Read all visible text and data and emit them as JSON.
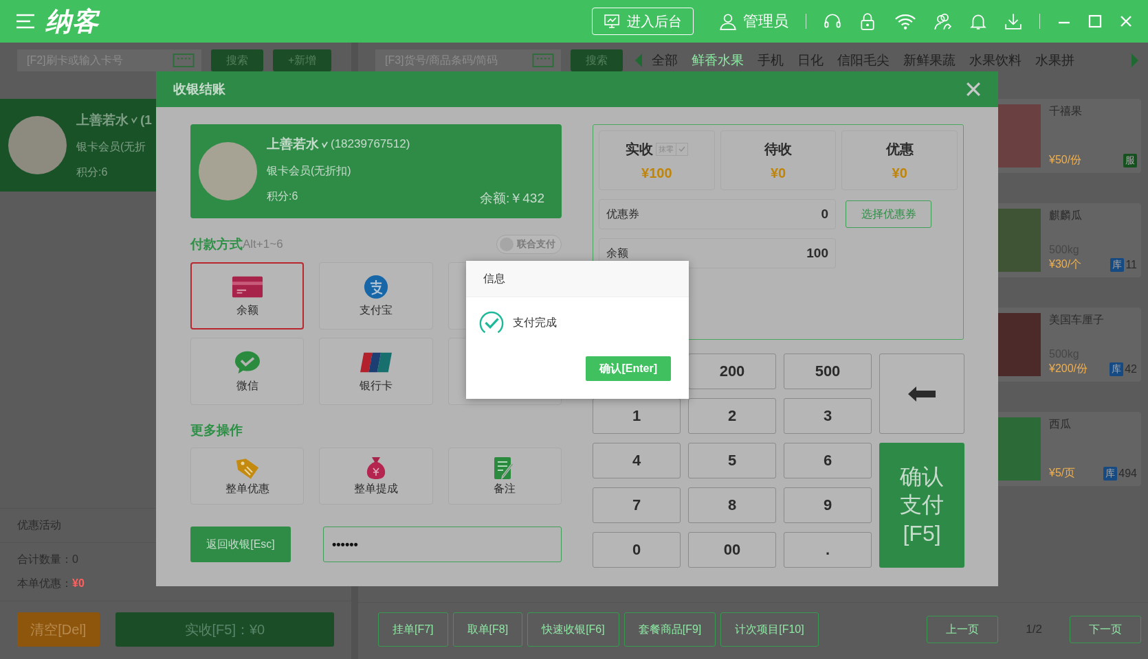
{
  "top_bar": {
    "logo": "纳客",
    "backend_button": "进入后台",
    "user": "管理员"
  },
  "member_panel": {
    "search_placeholder": "[F2]刷卡或输入卡号",
    "search_button": "搜索",
    "add_button": "+新增",
    "member": {
      "name": "上善若水",
      "phone": "(1",
      "level": "银卡会员(无折",
      "points": "积分:6"
    },
    "promo_label": "优惠活动",
    "total_qty": {
      "label": "合计数量：",
      "value": "0"
    },
    "discount": {
      "label": "本单优惠：",
      "value": "¥0"
    },
    "clear_button": "清空[Del]",
    "pay_button": "实收[F5]：¥0"
  },
  "goods_panel": {
    "search_placeholder": "[F3]货号/商品条码/简码",
    "search_button": "搜索",
    "categories": [
      {
        "label": "全部",
        "selected": false
      },
      {
        "label": "鲜香水果",
        "selected": true
      },
      {
        "label": "手机",
        "selected": false
      },
      {
        "label": "日化",
        "selected": false
      },
      {
        "label": "信阳毛尖",
        "selected": false
      },
      {
        "label": "新鲜果蔬",
        "selected": false
      },
      {
        "label": "水果饮料",
        "selected": false
      },
      {
        "label": "水果拼",
        "selected": false
      }
    ],
    "products": [
      {
        "kind": "service",
        "name": "千禧果",
        "price": "¥50/份",
        "badge": "服"
      },
      {
        "kind": "stock",
        "name": "麒麟瓜",
        "spec": "500kg",
        "price": "¥30/个",
        "badge": "库",
        "stock": "11"
      },
      {
        "kind": "stock",
        "name": "美国车厘子",
        "spec": "500kg",
        "price": "¥200/份",
        "badge": "库",
        "stock": "42"
      },
      {
        "kind": "stock",
        "name": "西瓜",
        "price": "¥5/页",
        "badge": "库",
        "stock": "494"
      }
    ],
    "actions": [
      "挂单[F7]",
      "取单[F8]",
      "快速收银[F6]",
      "套餐商品[F9]",
      "计次项目[F10]"
    ],
    "pager": {
      "prev": "上一页",
      "page": "1/2",
      "next": "下一页"
    }
  },
  "checkout_dialog": {
    "title": "收银结账",
    "member": {
      "name": "上善若水",
      "phone": "(18239767512)",
      "level": "银卡会员(无折扣)",
      "points": "积分:6",
      "balance": "余额:￥432"
    },
    "payment_title": "付款方式",
    "payment_hint": "Alt+1~6",
    "combined_toggle": {
      "label": "联合支付",
      "on": false
    },
    "payment_methods": [
      {
        "kind": "balance",
        "label": "余额",
        "selected": true
      },
      {
        "kind": "alipay",
        "label": "支付宝",
        "selected": false
      },
      {
        "kind": "wechat",
        "label": "微信",
        "selected": false
      },
      {
        "kind": "unionpay",
        "label": "银行卡",
        "selected": false
      }
    ],
    "more_title": "更多操作",
    "more_actions": [
      {
        "kind": "tag",
        "label": "整单优惠"
      },
      {
        "kind": "moneybag",
        "label": "整单提成"
      },
      {
        "kind": "note",
        "label": "备注"
      }
    ],
    "back_button": "返回收银[Esc]",
    "password_value": "••••••",
    "summary": [
      {
        "label": "实收",
        "value": "¥100",
        "round_off": {
          "label": "抹零",
          "checked": true
        }
      },
      {
        "label": "待收",
        "value": "¥0"
      },
      {
        "label": "优惠",
        "value": "¥0"
      }
    ],
    "coupon": {
      "label": "优惠券",
      "value": "0",
      "button": "选择优惠券"
    },
    "balance_pay": {
      "label": "余额",
      "value": "100"
    },
    "keypad": [
      "200",
      "500",
      "1",
      "2",
      "3",
      "4",
      "5",
      "6",
      "7",
      "8",
      "9",
      "0",
      "00",
      "."
    ],
    "confirm_button": "确认支付[F5]"
  },
  "info_dialog": {
    "title": "信息",
    "message": "支付完成",
    "confirm_button": "确认[Enter]"
  }
}
